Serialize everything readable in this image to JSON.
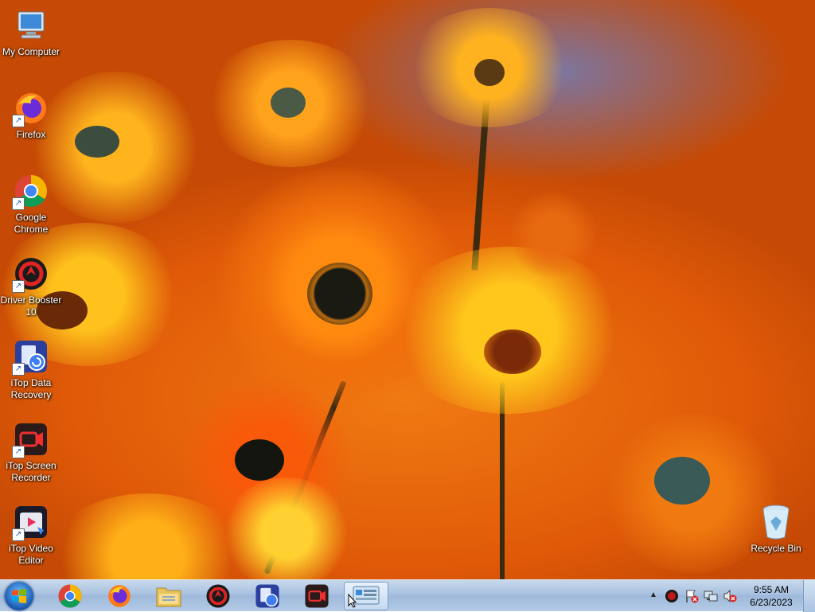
{
  "desktop": {
    "icons": [
      {
        "label": "My Computer",
        "icon": "computer-icon"
      },
      {
        "label": "Firefox",
        "icon": "firefox-icon"
      },
      {
        "label": "Google Chrome",
        "icon": "chrome-icon"
      },
      {
        "label": "Driver Booster 10",
        "icon": "driver-booster-icon"
      },
      {
        "label": "iTop Data Recovery",
        "icon": "itop-data-recovery-icon"
      },
      {
        "label": "iTop Screen Recorder",
        "icon": "itop-screen-recorder-icon"
      },
      {
        "label": "iTop Video Editor",
        "icon": "itop-video-editor-icon"
      },
      {
        "label": "Recycle Bin",
        "icon": "recycle-bin-icon"
      }
    ]
  },
  "taskbar": {
    "pinned": [
      {
        "icon": "chrome-icon"
      },
      {
        "icon": "firefox-icon"
      },
      {
        "icon": "file-explorer-icon"
      },
      {
        "icon": "driver-booster-icon"
      },
      {
        "icon": "itop-data-recovery-icon"
      },
      {
        "icon": "itop-screen-recorder-icon"
      },
      {
        "icon": "control-panel-icon"
      }
    ],
    "clock": {
      "time": "9:55 AM",
      "date": "6/23/2023"
    },
    "tray_icons": [
      "show-hidden-icons",
      "driver-booster-tray-icon",
      "action-center-icon",
      "network-icon",
      "volume-muted-icon"
    ]
  }
}
